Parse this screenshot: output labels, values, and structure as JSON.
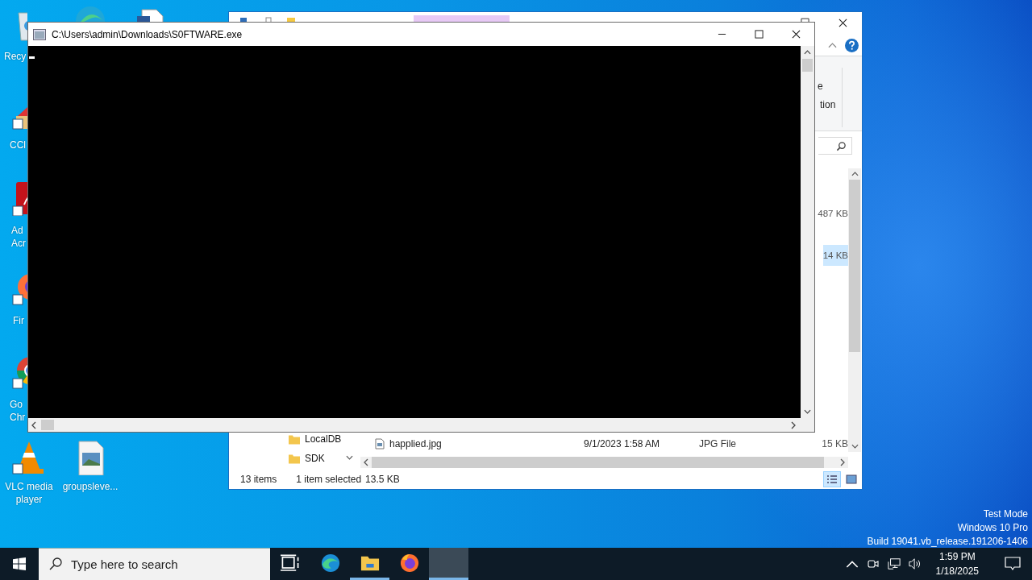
{
  "desktop_icons": [
    {
      "kind": "recycle-bin",
      "label_lines": [
        "Recy"
      ]
    },
    {
      "kind": "edge"
    },
    {
      "kind": "word-document"
    },
    {
      "kind": "ccleaner",
      "label_lines": [
        "CCl"
      ]
    },
    {
      "kind": "acrobat",
      "label_lines": [
        "Ad",
        "Acr"
      ]
    },
    {
      "kind": "firefox",
      "label_lines": [
        "Fir"
      ]
    },
    {
      "kind": "chrome",
      "label_lines": [
        "Go",
        "Chr"
      ]
    },
    {
      "kind": "vlc",
      "label_lines": [
        "VLC media",
        "player"
      ]
    },
    {
      "kind": "image-file",
      "label_lines": [
        "groupsleve..."
      ]
    }
  ],
  "desktop_notice": [
    "Test Mode",
    "Windows 10 Pro",
    "Build 19041.vb_release.191206-1406"
  ],
  "explorer": {
    "ribbon_fragments": [
      "e",
      "tion"
    ],
    "navigation": [
      {
        "label": "LocalDB"
      },
      {
        "label": "SDK"
      }
    ],
    "files": [
      {
        "size": "487 KB",
        "selected": false
      },
      {
        "size": "14 KB",
        "selected": true
      },
      {
        "name": "happlied.jpg",
        "date": "9/1/2023 1:58 AM",
        "type": "JPG File",
        "size": "15 KB",
        "selected": false
      }
    ],
    "status_bar": {
      "item_count": "13 items",
      "selection": "1 item selected",
      "selection_size": "13.5 KB"
    },
    "views": [
      {
        "kind": "details",
        "selected": true
      },
      {
        "kind": "large-icons",
        "selected": false
      }
    ]
  },
  "console": {
    "title": "C:\\Users\\admin\\Downloads\\S0FTWARE.exe"
  },
  "taskbar": {
    "search": {
      "placeholder": "Type here to search"
    },
    "apps": [
      {
        "kind": "edge",
        "running": false,
        "active": false
      },
      {
        "kind": "explorer",
        "running": true,
        "active": false
      },
      {
        "kind": "firefox",
        "running": false,
        "active": false
      },
      {
        "kind": "console",
        "running": true,
        "active": true
      }
    ],
    "clock": {
      "time": "1:59 PM",
      "date": "1/18/2025"
    }
  }
}
